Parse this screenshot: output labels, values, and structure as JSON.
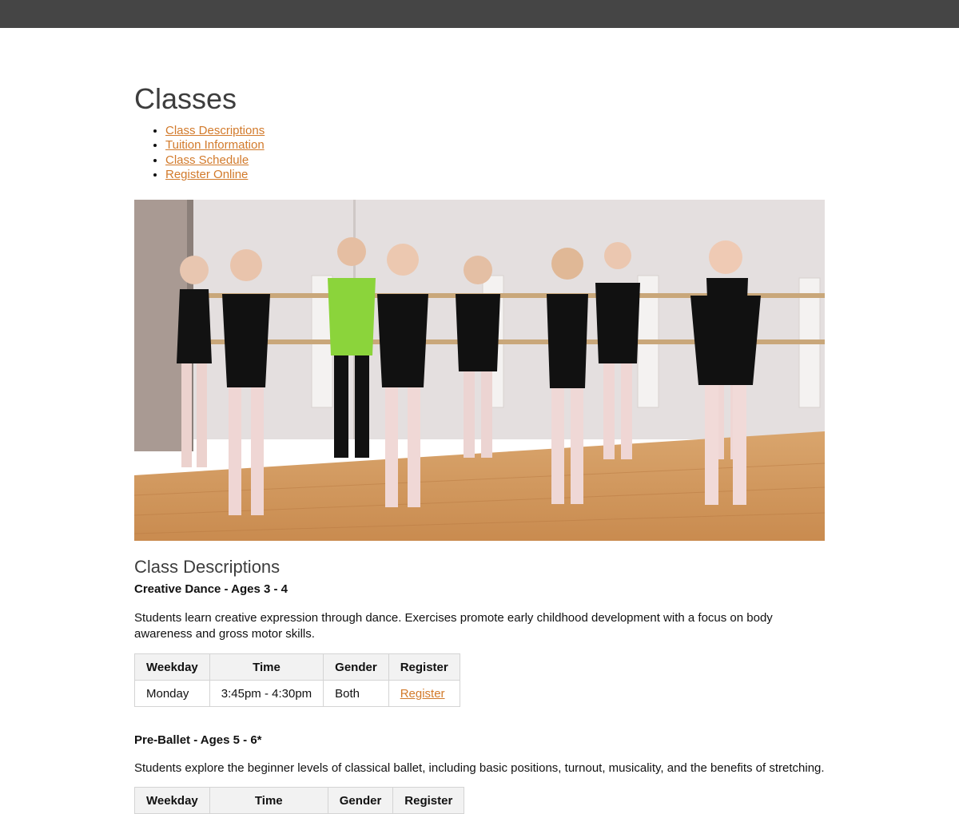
{
  "page": {
    "title": "Classes",
    "nav": [
      {
        "label": "Class Descriptions"
      },
      {
        "label": "Tuition Information"
      },
      {
        "label": "Class Schedule"
      },
      {
        "label": "Register Online"
      }
    ]
  },
  "section": {
    "title": "Class Descriptions"
  },
  "classes": [
    {
      "title": "Creative Dance - Ages 3 - 4",
      "description": "Students learn creative expression through dance. Exercises promote early childhood development with a focus on body awareness and gross motor skills.",
      "table": {
        "headers": [
          "Weekday",
          "Time",
          "Gender",
          "Register"
        ],
        "rows": [
          {
            "weekday": "Monday",
            "time": "3:45pm - 4:30pm",
            "gender": "Both",
            "register": "Register"
          }
        ]
      }
    },
    {
      "title": "Pre-Ballet - Ages 5 - 6*",
      "description": "Students explore the beginner levels of classical ballet, including basic positions, turnout, musicality, and the benefits of stretching.",
      "table": {
        "headers": [
          "Weekday",
          "Time",
          "Gender",
          "Register"
        ]
      }
    }
  ],
  "colors": {
    "header_bar": "#454545",
    "link": "#d27a2b",
    "heading": "#3d3d3d",
    "table_header_bg": "#f2f2f2",
    "table_border": "#d4d4d4"
  }
}
